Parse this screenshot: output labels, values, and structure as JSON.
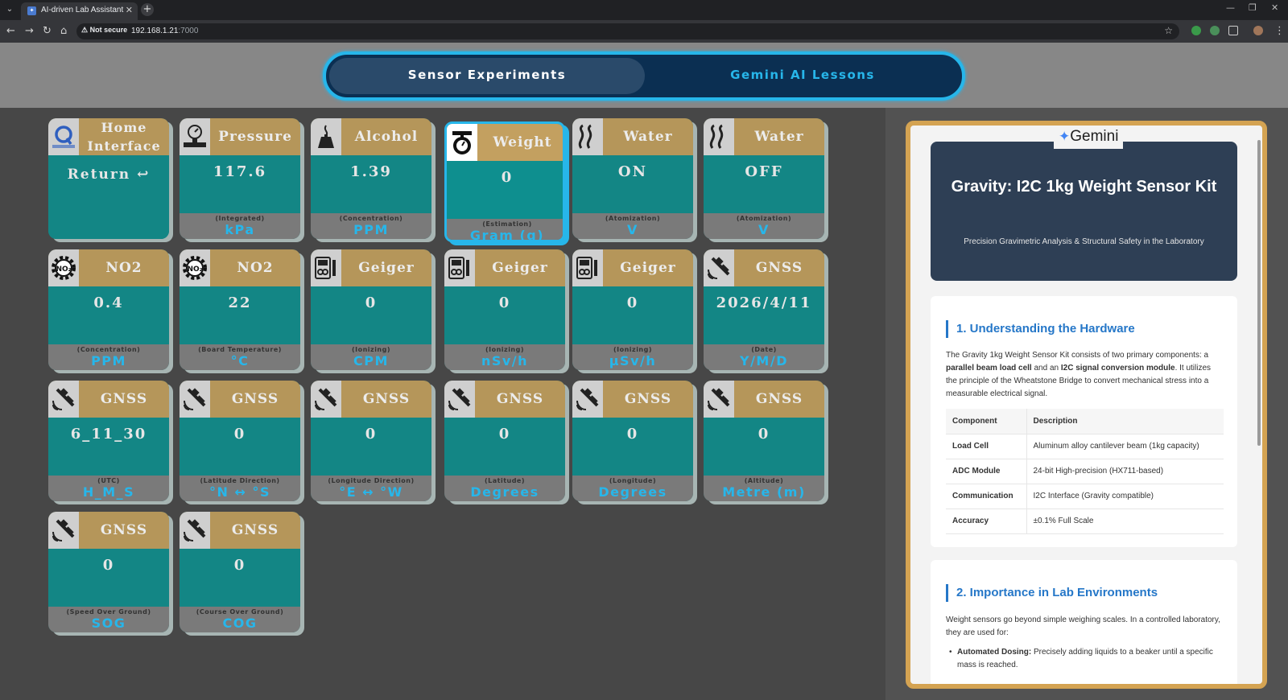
{
  "browser": {
    "tab_title": "AI-driven Lab Assistant",
    "tab_close": "✕",
    "new_tab": "+",
    "not_secure": "Not secure",
    "url_host": "192.168.1.21",
    "url_port": ":7000"
  },
  "switcher": {
    "left_label": "Sensor Experiments",
    "right_label": "Gemini AI Lessons"
  },
  "cards": [
    {
      "title": "Home Interface",
      "value": "Return ↩",
      "sub": "",
      "unit": "",
      "icon": "qualcomm-logo-icon"
    },
    {
      "title": "Pressure",
      "value": "117.6",
      "sub": "(Integrated)",
      "unit": "kPa",
      "icon": "pressure-gauge-icon"
    },
    {
      "title": "Alcohol",
      "value": "1.39",
      "sub": "(Concentration)",
      "unit": "PPM",
      "icon": "alcohol-burner-icon"
    },
    {
      "title": "Weight",
      "value": "0",
      "sub": "(Estimation)",
      "unit": "Gram (g)",
      "icon": "scale-icon"
    },
    {
      "title": "Water",
      "value": "ON",
      "sub": "(Atomization)",
      "unit": "V",
      "icon": "steam-icon"
    },
    {
      "title": "Water",
      "value": "OFF",
      "sub": "(Atomization)",
      "unit": "V",
      "icon": "steam-icon"
    },
    {
      "title": "NO2",
      "value": "0.4",
      "sub": "(Concentration)",
      "unit": "PPM",
      "icon": "no2-gear-icon"
    },
    {
      "title": "NO2",
      "value": "22",
      "sub": "(Board Temperature)",
      "unit": "°C",
      "icon": "no2-gear-icon"
    },
    {
      "title": "Geiger",
      "value": "0",
      "sub": "(Ionizing)",
      "unit": "CPM",
      "icon": "geiger-counter-icon"
    },
    {
      "title": "Geiger",
      "value": "0",
      "sub": "(Ionizing)",
      "unit": "nSv/h",
      "icon": "geiger-counter-icon"
    },
    {
      "title": "Geiger",
      "value": "0",
      "sub": "(Ionizing)",
      "unit": "μSv/h",
      "icon": "geiger-counter-icon"
    },
    {
      "title": "GNSS",
      "value": "2026/4/11",
      "sub": "(Date)",
      "unit": "Y/M/D",
      "icon": "satellite-icon"
    },
    {
      "title": "GNSS",
      "value": "6_11_30",
      "sub": "(UTC)",
      "unit": "H_M_S",
      "icon": "satellite-icon"
    },
    {
      "title": "GNSS",
      "value": "0",
      "sub": "(Latitude Direction)",
      "unit": "°N ↔ °S",
      "icon": "satellite-icon"
    },
    {
      "title": "GNSS",
      "value": "0",
      "sub": "(Longitude Direction)",
      "unit": "°E ↔ °W",
      "icon": "satellite-icon"
    },
    {
      "title": "GNSS",
      "value": "0",
      "sub": "(Latitude)",
      "unit": "Degrees",
      "icon": "satellite-icon"
    },
    {
      "title": "GNSS",
      "value": "0",
      "sub": "(Longitude)",
      "unit": "Degrees",
      "icon": "satellite-icon"
    },
    {
      "title": "GNSS",
      "value": "0",
      "sub": "(Altitude)",
      "unit": "Metre (m)",
      "icon": "satellite-icon"
    },
    {
      "title": "GNSS",
      "value": "0",
      "sub": "(Speed Over Ground)",
      "unit": "SOG",
      "icon": "satellite-icon"
    },
    {
      "title": "GNSS",
      "value": "0",
      "sub": "(Course Over Ground)",
      "unit": "COG",
      "icon": "satellite-icon"
    }
  ],
  "gemini": {
    "logo": "Gemini",
    "hero_title": "Gravity: I2C 1kg Weight Sensor Kit",
    "hero_subtitle": "Precision Gravimetric Analysis & Structural Safety in the Laboratory",
    "section1": {
      "heading": "1. Understanding the Hardware",
      "para_a": "The Gravity 1kg Weight Sensor Kit consists of two primary components: a",
      "bold_a": "parallel beam load cell",
      "para_b": " and an ",
      "bold_b": "I2C signal conversion module",
      "para_c": ". It utilizes the principle of the Wheatstone Bridge to convert mechanical stress into a measurable electrical signal.",
      "table_head": [
        "Component",
        "Description"
      ],
      "table_rows": [
        [
          "Load Cell",
          "Aluminum alloy cantilever beam (1kg capacity)"
        ],
        [
          "ADC Module",
          "24-bit High-precision (HX711-based)"
        ],
        [
          "Communication",
          "I2C Interface (Gravity compatible)"
        ],
        [
          "Accuracy",
          "±0.1% Full Scale"
        ]
      ]
    },
    "section2": {
      "heading": "2. Importance in Lab Environments",
      "para": "Weight sensors go beyond simple weighing scales. In a controlled laboratory, they are used for:",
      "bullet_bold": "Automated Dosing:",
      "bullet_text": " Precisely adding liquids to a beaker until a specific mass is reached."
    }
  }
}
